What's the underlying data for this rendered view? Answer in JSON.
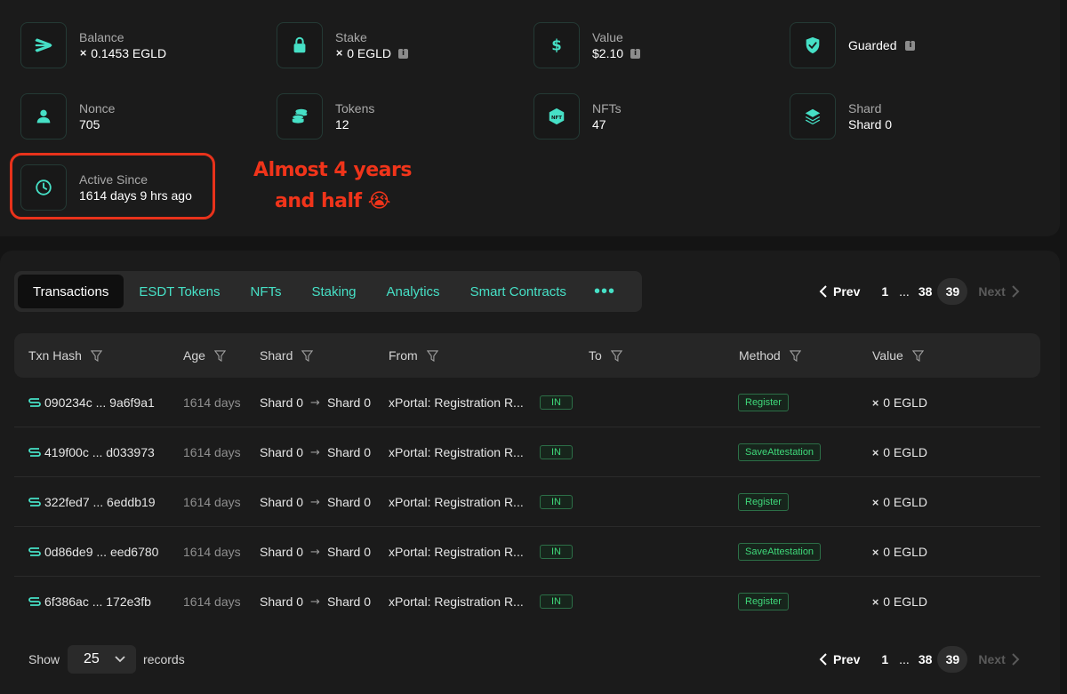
{
  "stats": {
    "balance": {
      "label": "Balance",
      "value": "0.1453 EGLD",
      "currency_glyph": "⨯"
    },
    "stake": {
      "label": "Stake",
      "value": "0 EGLD",
      "currency_glyph": "⨯"
    },
    "value": {
      "label": "Value",
      "value": "$2.10"
    },
    "guarded": {
      "label": "Guarded"
    },
    "nonce": {
      "label": "Nonce",
      "value": "705"
    },
    "tokens": {
      "label": "Tokens",
      "value": "12"
    },
    "nfts": {
      "label": "NFTs",
      "value": "47",
      "icon_text": "NFT"
    },
    "shard": {
      "label": "Shard",
      "value": "Shard 0"
    },
    "active_since": {
      "label": "Active Since",
      "value": "1614 days 9 hrs ago"
    }
  },
  "annotation": {
    "line1": "Almost 4 years",
    "line2": "and half 😭"
  },
  "tabs": [
    "Transactions",
    "ESDT Tokens",
    "NFTs",
    "Staking",
    "Analytics",
    "Smart Contracts"
  ],
  "tabs_more": "•••",
  "pagination": {
    "prev": "Prev",
    "first": "1",
    "ellipsis": "...",
    "prev_page": "38",
    "current": "39",
    "next": "Next"
  },
  "table": {
    "headers": [
      "Txn Hash",
      "Age",
      "Shard",
      "From",
      "To",
      "Method",
      "Value"
    ],
    "rows": [
      {
        "hash": "090234c ... 9a6f9a1",
        "age": "1614 days",
        "shard_from": "Shard 0",
        "shard_to": "Shard 0",
        "from": "xPortal: Registration R...",
        "direction": "IN",
        "method": "Register",
        "value": "0 EGLD"
      },
      {
        "hash": "419f00c ... d033973",
        "age": "1614 days",
        "shard_from": "Shard 0",
        "shard_to": "Shard 0",
        "from": "xPortal: Registration R...",
        "direction": "IN",
        "method": "SaveAttestation",
        "value": "0 EGLD"
      },
      {
        "hash": "322fed7 ... 6eddb19",
        "age": "1614 days",
        "shard_from": "Shard 0",
        "shard_to": "Shard 0",
        "from": "xPortal: Registration R...",
        "direction": "IN",
        "method": "Register",
        "value": "0 EGLD"
      },
      {
        "hash": "0d86de9 ... eed6780",
        "age": "1614 days",
        "shard_from": "Shard 0",
        "shard_to": "Shard 0",
        "from": "xPortal: Registration R...",
        "direction": "IN",
        "method": "SaveAttestation",
        "value": "0 EGLD"
      },
      {
        "hash": "6f386ac ... 172e3fb",
        "age": "1614 days",
        "shard_from": "Shard 0",
        "shard_to": "Shard 0",
        "from": "xPortal: Registration R...",
        "direction": "IN",
        "method": "Register",
        "value": "0 EGLD"
      }
    ],
    "value_glyph": "⨯",
    "shard_arrow": "→"
  },
  "footer": {
    "show_label": "Show",
    "page_size": "25",
    "records_label": "records"
  },
  "colors": {
    "accent": "#46e0c6",
    "highlight": "#e8321b",
    "success": "#3fd97a",
    "background": "#141414"
  }
}
